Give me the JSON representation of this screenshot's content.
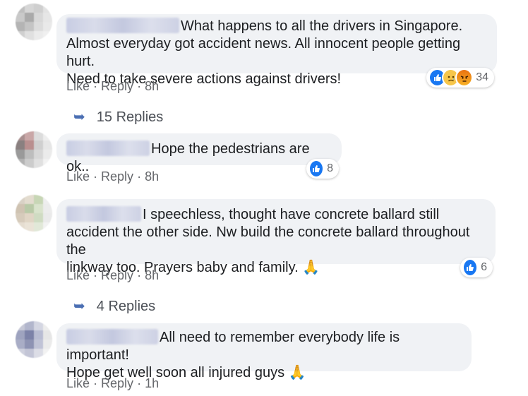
{
  "comments": [
    {
      "text": "What happens to all the drivers in Singapore. Almost everyday got accident news. All innocent people getting hurt. Need to take severe actions against drivers!",
      "line1": "What happens to all the drivers in Singapore.",
      "line2": "Almost everyday got accident news. All innocent people getting hurt.",
      "line3": "Need to take severe actions against drivers!",
      "like": "Like",
      "reply": "Reply",
      "time": "8h",
      "reaction_icons": [
        "like-icon",
        "sad-icon",
        "angry-icon"
      ],
      "reaction_count": "34",
      "replies_label": "15 Replies"
    },
    {
      "line1": "Hope the pedestrians are ok..",
      "like": "Like",
      "reply": "Reply",
      "time": "8h",
      "reaction_icons": [
        "like-icon"
      ],
      "reaction_count": "8"
    },
    {
      "line1": "I speechless, thought have concrete ballard still",
      "line2": "accident the other side. Nw build the concrete ballard throughout the",
      "line3": "linkway too. Prayers baby and family.",
      "emoji": "🙏",
      "like": "Like",
      "reply": "Reply",
      "time": "8h",
      "reaction_icons": [
        "like-icon"
      ],
      "reaction_count": "6",
      "replies_label": "4 Replies"
    },
    {
      "line1": "All need to remember everybody life is important!",
      "line2": "Hope get well soon all injured guys",
      "emoji": "🙏",
      "like": "Like",
      "reply": "Reply",
      "time": "1h"
    }
  ],
  "separator": "·",
  "colors": {
    "bubble": "#f0f2f5",
    "like_blue": "#1877f2",
    "meta_gray": "#65676b",
    "reply_arrow": "#4b6fb3"
  }
}
